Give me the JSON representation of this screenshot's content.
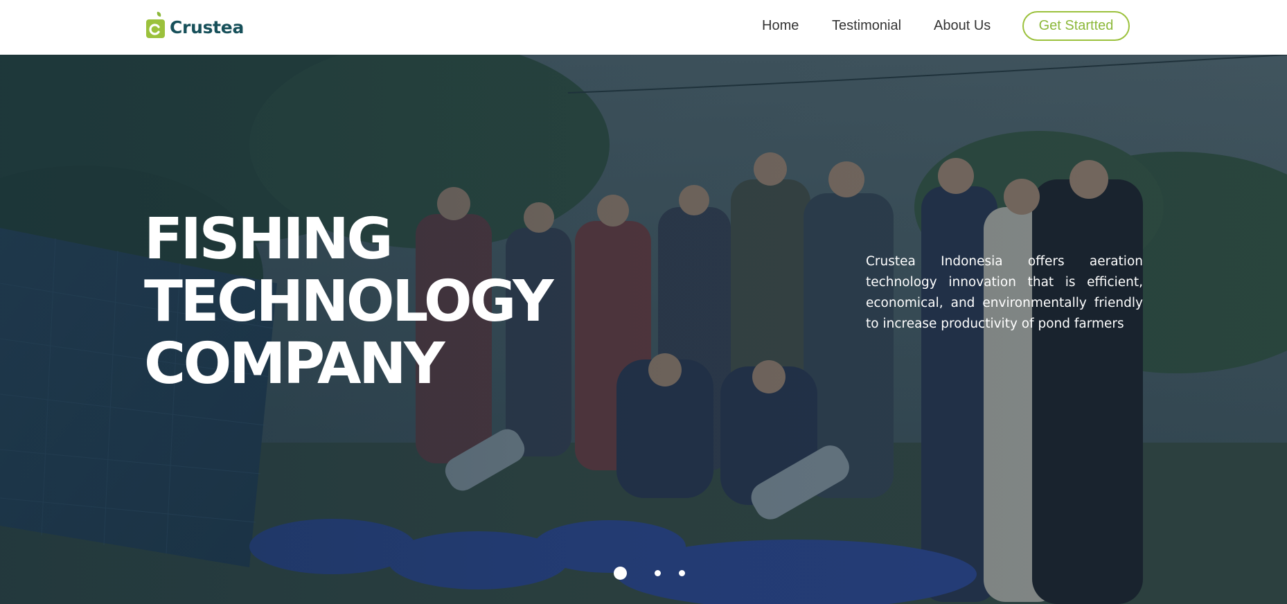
{
  "brand": {
    "name": "Crustea",
    "logo_icon": "leaf-c-logo-icon",
    "color": "#17505a",
    "accent": "#9bc13c"
  },
  "nav": {
    "items": [
      {
        "label": "Home"
      },
      {
        "label": "Testimonial"
      },
      {
        "label": "About Us"
      }
    ],
    "cta_label": "Get Startted"
  },
  "hero": {
    "title_lines": [
      "FISHING",
      "TECHNOLOGY",
      "COMPANY"
    ],
    "description": "Crustea Indonesia offers aeration technology innovation that is efficient, economical, and environmentally friendly to increase productivity of pond farmers",
    "background_image": "team-photo-with-aerators-and-solar-panel",
    "slides": {
      "count": 3,
      "active": 1
    }
  }
}
